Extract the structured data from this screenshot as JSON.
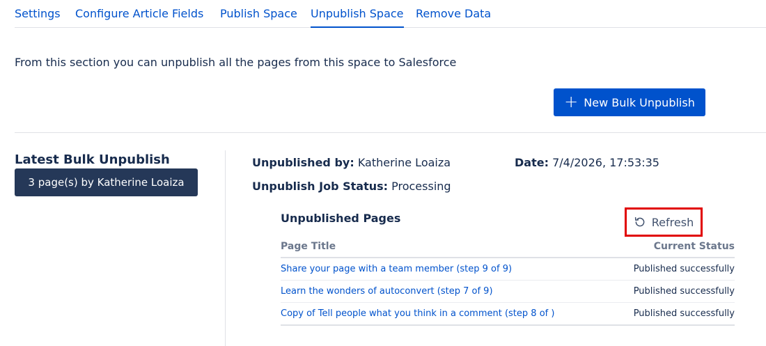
{
  "tabs": [
    {
      "label": "Settings"
    },
    {
      "label": "Configure Article Fields"
    },
    {
      "label": "Publish Space"
    },
    {
      "label": "Unpublish Space",
      "active": true
    },
    {
      "label": "Remove Data"
    }
  ],
  "intro_text": "From this section you can unpublish all the pages from this space to Salesforce",
  "new_bulk_button": {
    "icon": "plus-icon",
    "label": "New Bulk Unpublish"
  },
  "latest": {
    "title": "Latest Bulk Unpublish",
    "badge": "3 page(s) by Katherine Loaiza"
  },
  "job": {
    "unpublished_by_label": "Unpublished by:",
    "unpublished_by_value": "Katherine Loaiza",
    "date_label": "Date:",
    "date_value": "7/4/2026, 17:53:35",
    "status_label": "Unpublish Job Status:",
    "status_value": "Processing"
  },
  "pages_section": {
    "title": "Unpublished Pages",
    "refresh": {
      "icon": "refresh-icon",
      "label": "Refresh"
    },
    "columns": [
      "Page Title",
      "Current Status"
    ],
    "rows": [
      {
        "title": "Share your page with a team member (step 9 of 9)",
        "status": "Published successfully"
      },
      {
        "title": "Learn the wonders of autoconvert (step 7 of 9)",
        "status": "Published successfully"
      },
      {
        "title": "Copy of Tell people what you think in a comment (step 8 of )",
        "status": "Published successfully"
      }
    ]
  },
  "colors": {
    "link": "#0052cc",
    "primary_button": "#0052cc",
    "badge_bg": "#253858",
    "text": "#172b4d",
    "muted": "#6b778c",
    "highlight_border": "#e10000"
  }
}
